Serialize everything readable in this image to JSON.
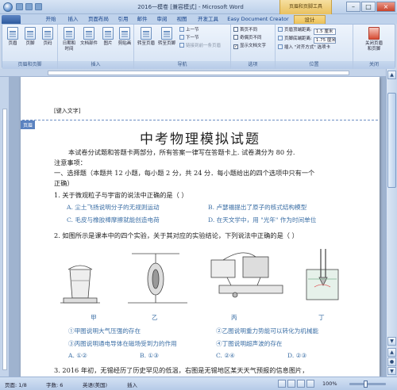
{
  "window": {
    "title": "2016一模卷 [兼容模式] - Microsoft Word",
    "context_tab_title": "页眉和页脚工具",
    "minimize": "–",
    "maximize": "□",
    "close": "×"
  },
  "tabs": [
    {
      "label": "",
      "active": false
    },
    {
      "label": "开始",
      "active": false
    },
    {
      "label": "插入",
      "active": false
    },
    {
      "label": "页面布局",
      "active": false
    },
    {
      "label": "引用",
      "active": false
    },
    {
      "label": "邮件",
      "active": false
    },
    {
      "label": "审阅",
      "active": false
    },
    {
      "label": "视图",
      "active": false
    },
    {
      "label": "开发工具",
      "active": false
    },
    {
      "label": "Easy Document Creator",
      "active": false
    },
    {
      "label": "设计",
      "active": true
    }
  ],
  "ribbon": {
    "group1": {
      "label": "页眉和页脚",
      "btn1": "页眉",
      "btn2": "页脚",
      "btn3": "页码"
    },
    "group2": {
      "label": "插入",
      "btn1": "日期和\n时间",
      "btn2": "文档部件",
      "btn3": "图片",
      "btn4": "剪贴画"
    },
    "group3": {
      "label": "导航",
      "btn1": "转至页眉",
      "btn2": "转至页脚",
      "prev": "上一节",
      "next": "下一节",
      "link": "链接到前一条页眉"
    },
    "group4": {
      "label": "选项",
      "opt1": "首页不同",
      "opt2": "奇偶页不同",
      "opt3": "显示文档文字",
      "opt3_checked": "✓"
    },
    "group5": {
      "label": "位置",
      "top_label": "页眉顶端距离:",
      "top_value": "1.5 厘米",
      "bottom_label": "页脚底端距离:",
      "bottom_value": "1.75 厘米",
      "align": "插入 \"对齐方式\" 选项卡"
    },
    "group6": {
      "label": "关闭",
      "btn": "关闭页眉\n和页脚"
    }
  },
  "document": {
    "header_text": "[键入文字]",
    "header_tag": "页眉",
    "title": "中考物理模拟试题",
    "lines": [
      "本试卷分试题和答题卡两部分，所有答案一律写在答题卡上. 试卷满分为 80 分.",
      "注意事项：",
      "一、选择题（本题共 12 小题，每小题 2 分，共 24 分．每小题给出的四个选项中只有一个",
      "正确）",
      "1. 关于微观粒子与宇宙的说法中正确的是（      ）",
      "2. 如图所示是课本中的四个实验，关于其对应的实验结论，下列说法中正确的是（      ）",
      "3. 2016 年初，无锡经历了历史罕见的低温，右图是无锡地区某天天气预报的信息图片，"
    ],
    "q1_options": [
      "A. 尘土飞扬说明分子的无规则运动",
      "B. 卢瑟福提出了原子的核式结构模型",
      "C. 毛皮与橡胶棒摩擦就能创造电荷",
      "D. 在天文学中，用 \"光年\" 作为时间单位"
    ],
    "fig_captions": [
      "甲",
      "乙",
      "丙",
      "丁"
    ],
    "q2_options": [
      "①甲图说明大气压强的存在",
      "②乙图说明重力势能可以转化为机械能",
      "③丙图说明通电导体在磁场受到力的作用",
      "④丁图说明超声波的存在"
    ],
    "q2_choices": [
      "A. ①②",
      "B. ①③",
      "C. ②④",
      "D. ②③"
    ]
  },
  "statusbar": {
    "page": "页面: 1/8",
    "words": "字数: 6",
    "lang": "英语(美国)",
    "insert": "插入",
    "zoom": "100%"
  }
}
